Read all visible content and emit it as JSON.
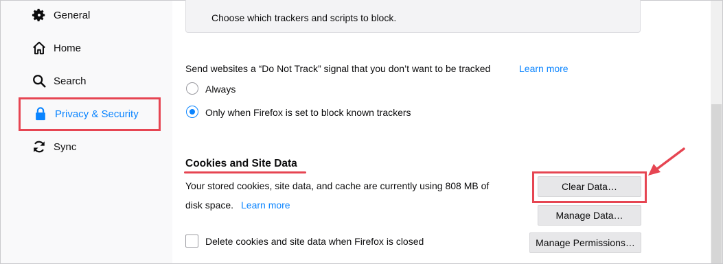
{
  "sidebar": {
    "items": [
      {
        "label": "General",
        "icon": "gear-icon"
      },
      {
        "label": "Home",
        "icon": "home-icon"
      },
      {
        "label": "Search",
        "icon": "search-icon"
      },
      {
        "label": "Privacy & Security",
        "icon": "lock-icon",
        "active": true
      },
      {
        "label": "Sync",
        "icon": "sync-icon"
      }
    ]
  },
  "trackers": {
    "description": "Choose which trackers and scripts to block."
  },
  "do_not_track": {
    "label": "Send websites a “Do Not Track” signal that you don’t want to be tracked",
    "learn_more": "Learn more",
    "options": [
      {
        "label": "Always",
        "selected": false
      },
      {
        "label": "Only when Firefox is set to block known trackers",
        "selected": true
      }
    ]
  },
  "cookies": {
    "title": "Cookies and Site Data",
    "usage_line1": "Your stored cookies, site data, and cache are currently using 808 MB of",
    "usage_line2": "disk space.",
    "learn_more": "Learn more",
    "buttons": {
      "clear": "Clear Data…",
      "manage": "Manage Data…",
      "permissions": "Manage Permissions…"
    },
    "delete_on_close": {
      "label": "Delete cookies and site data when Firefox is closed",
      "checked": false
    }
  },
  "colors": {
    "accent": "#0a84ff",
    "annotation": "#e64552"
  }
}
